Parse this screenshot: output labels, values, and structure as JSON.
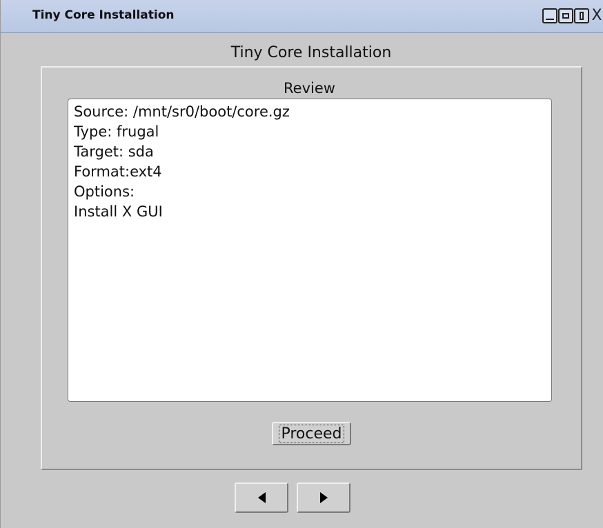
{
  "window": {
    "title": "Tiny Core Installation",
    "controls": [
      "minimize-icon",
      "shade-icon",
      "maximize-icon",
      "close-icon"
    ],
    "close_glyph": "X"
  },
  "dialog": {
    "heading": "Tiny Core Installation",
    "group_label": "Review",
    "review_lines": [
      "Source: /mnt/sr0/boot/core.gz",
      "Type: frugal",
      "Target: sda",
      "Format:ext4",
      "Options:",
      "Install X GUI"
    ],
    "proceed_label": "Proceed"
  },
  "navigation": {
    "back_icon": "triangle-left-icon",
    "next_icon": "triangle-right-icon"
  },
  "colors": {
    "titlebar": "#b8c7e3",
    "background": "#c9c9c9",
    "text_area": "#ffffff"
  }
}
